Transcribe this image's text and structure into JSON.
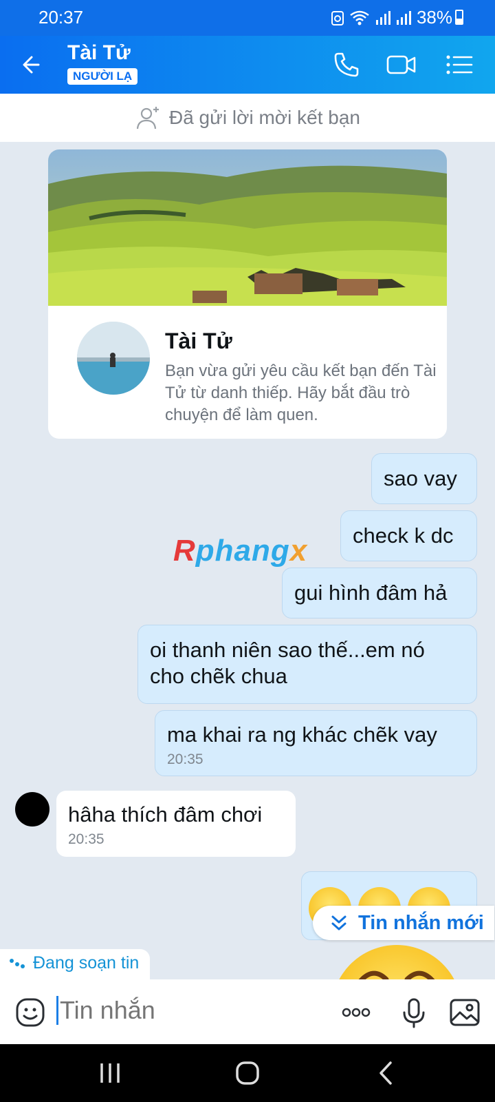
{
  "status": {
    "time": "20:37",
    "battery": "38%"
  },
  "header": {
    "name": "Tài Tử",
    "badge": "NGƯỜI LẠ"
  },
  "friend_bar": {
    "text": "Đã gửi lời mời kết bạn"
  },
  "card": {
    "name": "Tài Tử",
    "description": "Bạn vừa gửi yêu cầu kết bạn đến Tài Tử từ danh thiếp. Hãy bắt đầu trò chuyện để làm quen."
  },
  "watermark": {
    "part1": "R",
    "part2": "phang",
    "part3": "x"
  },
  "messages": [
    {
      "text": "sao vay",
      "dir": "out"
    },
    {
      "text": "check k dc",
      "dir": "out"
    },
    {
      "text": "gui hình đâm hả",
      "dir": "out"
    },
    {
      "text": "oi thanh niên sao thế...em nó cho chẽk chua",
      "dir": "out"
    },
    {
      "text": "ma khai ra ng khác chẽk vay",
      "time": "20:35",
      "dir": "out"
    },
    {
      "text": "hâha thích đâm chơi",
      "time": "20:35",
      "dir": "in"
    }
  ],
  "new_messages": {
    "label": "Tin nhắn mới"
  },
  "typing": {
    "label": "Đang soạn tin"
  },
  "input": {
    "placeholder": "Tin nhắn"
  },
  "colors": {
    "header_start": "#0a6ef0",
    "header_end": "#11a6ee",
    "outgoing_bubble": "#d6ecfd",
    "background": "#e2e9f1"
  }
}
